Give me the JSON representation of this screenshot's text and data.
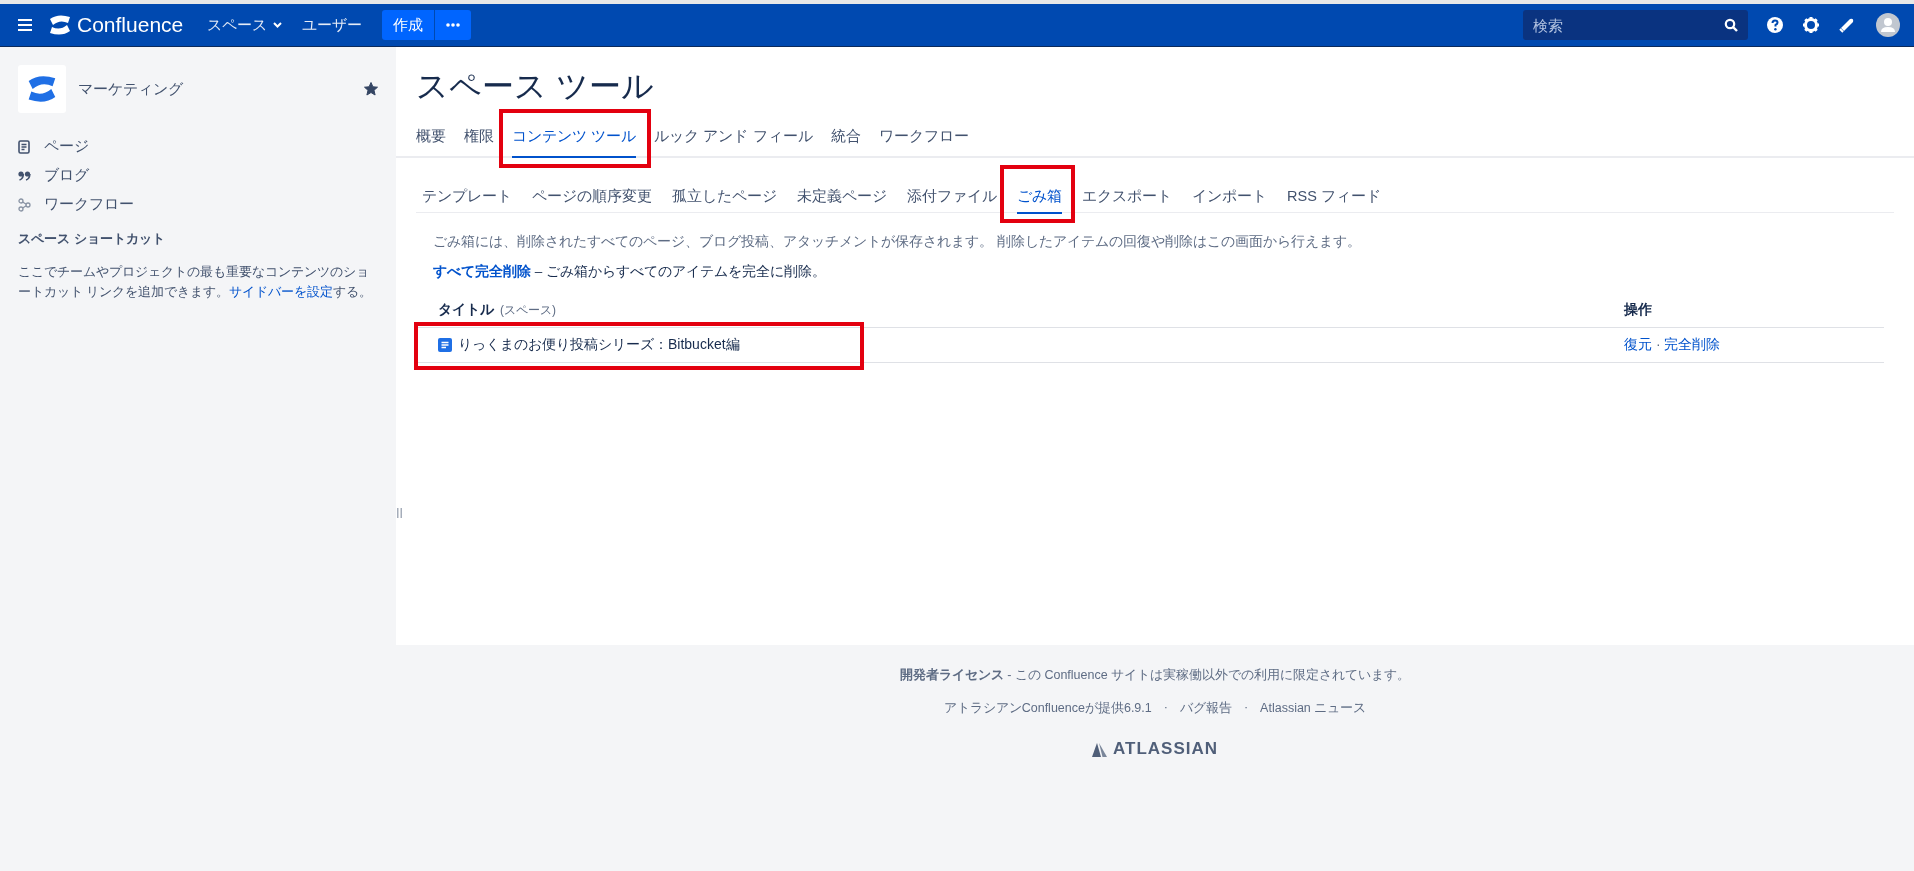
{
  "top_bar": {
    "product": "Confluence",
    "menus": [
      {
        "label": "スペース",
        "dropdown": true
      },
      {
        "label": "ユーザー",
        "dropdown": false
      }
    ],
    "create_button": "作成",
    "search": {
      "placeholder": "検索"
    }
  },
  "sidebar": {
    "space_name": "マーケティング",
    "starred": true,
    "nav": [
      {
        "label": "ページ",
        "kind": "page"
      },
      {
        "label": "ブログ",
        "kind": "blog"
      },
      {
        "label": "ワークフロー",
        "kind": "workflow"
      }
    ],
    "shortcuts_heading": "スペース ショートカット",
    "shortcuts_text": "ここでチームやプロジェクトの最も重要なコンテンツのショートカット リンクを追加できます。",
    "shortcuts_link": "サイドバーを設定",
    "shortcuts_suffix": "する。"
  },
  "page_title": "スペース ツール",
  "tabs": [
    {
      "label": "概要",
      "selected": false,
      "highlighted": false
    },
    {
      "label": "権限",
      "selected": false,
      "highlighted": false
    },
    {
      "label": "コンテンツ ツール",
      "selected": true,
      "highlighted": true
    },
    {
      "label": "ルック アンド フィール",
      "selected": false,
      "highlighted": false
    },
    {
      "label": "統合",
      "selected": false,
      "highlighted": false
    },
    {
      "label": "ワークフロー",
      "selected": false,
      "highlighted": false
    }
  ],
  "subtabs": [
    {
      "label": "テンプレート",
      "selected": false,
      "highlighted": false
    },
    {
      "label": "ページの順序変更",
      "selected": false,
      "highlighted": false
    },
    {
      "label": "孤立したページ",
      "selected": false,
      "highlighted": false
    },
    {
      "label": "未定義ページ",
      "selected": false,
      "highlighted": false
    },
    {
      "label": "添付ファイル",
      "selected": false,
      "highlighted": false
    },
    {
      "label": "ごみ箱",
      "selected": true,
      "highlighted": true
    },
    {
      "label": "エクスポート",
      "selected": false,
      "highlighted": false
    },
    {
      "label": "インポート",
      "selected": false,
      "highlighted": false
    },
    {
      "label": "RSS フィード",
      "selected": false,
      "highlighted": false
    }
  ],
  "trash": {
    "description": "ごみ箱には、削除されたすべてのページ、ブログ投稿、アタッチメントが保存されます。 削除したアイテムの回復や削除はこの画面から行えます。",
    "purge_link": "すべて完全削除",
    "purge_text": " – ごみ箱からすべてのアイテムを完全に削除。",
    "columns": [
      {
        "label": "タイトル",
        "note": "(スペース)"
      },
      {
        "label": "操作"
      }
    ],
    "rows": [
      {
        "title": "りっくまのお便り投稿シリーズ：Bitbucket編",
        "actions": [
          "復元",
          "完全削除"
        ],
        "highlighted": true
      }
    ],
    "action_separator": "·"
  },
  "footer": {
    "license": "**開発者ライセンス** - この Confluence サイトは実稼働以外での利用に限定されています。",
    "links": [
      "アトラシアンConfluenceが提供6.9.1",
      "バグ報告",
      "Atlassian ニュース"
    ],
    "separator": "·",
    "logo": "ATLASSIAN"
  }
}
